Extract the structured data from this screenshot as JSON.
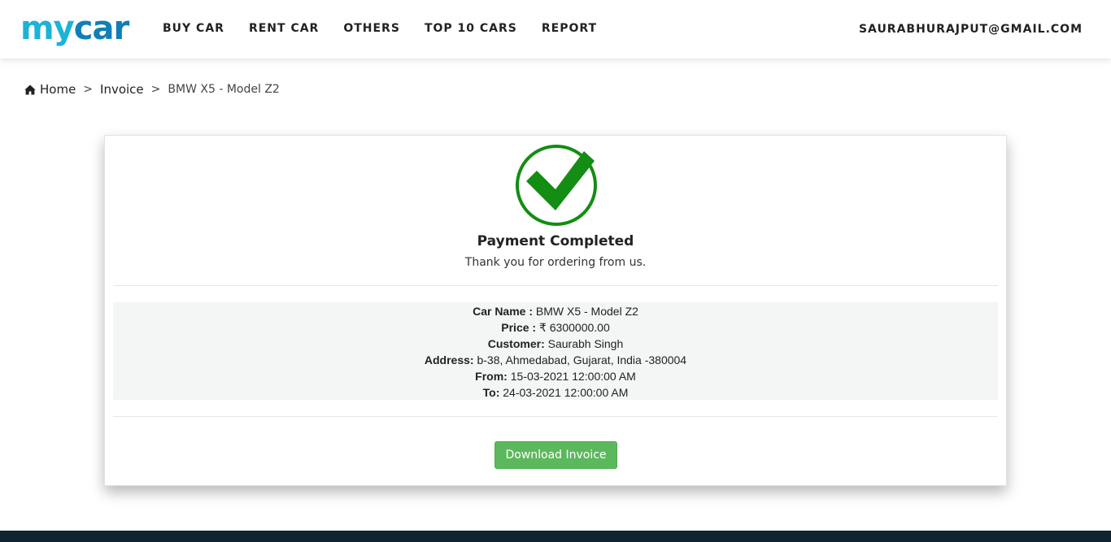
{
  "brand": {
    "logo_part1": "my",
    "logo_part2": "car",
    "colors": {
      "logo_light": "#1cb3d6",
      "logo_dark": "#0f7fb7"
    }
  },
  "nav": {
    "items": [
      {
        "label": "BUY CAR"
      },
      {
        "label": "RENT CAR"
      },
      {
        "label": "OTHERS"
      },
      {
        "label": "TOP 10 CARS"
      },
      {
        "label": "REPORT"
      }
    ],
    "user_email": "SAURABHURAJPUT@GMAIL.COM"
  },
  "breadcrumb": {
    "home_icon": "home-icon",
    "home": "Home",
    "separator": ">",
    "invoice": "Invoice",
    "current": "BMW X5 - Model Z2"
  },
  "payment": {
    "status_icon": "check-circle-icon",
    "status_color": "#138d13",
    "title": "Payment Completed",
    "subtitle": "Thank you for ordering from us."
  },
  "details": {
    "car_name_label": "Car Name :",
    "car_name": " BMW X5 - Model Z2",
    "price_label": "Price :",
    "price": " ₹ 6300000.00",
    "customer_label": "Customer:",
    "customer": " Saurabh Singh",
    "address_label": "Address:",
    "address": " b-38, Ahmedabad, Gujarat, India -380004",
    "from_label": "From:",
    "from": " 15-03-2021 12:00:00 AM",
    "to_label": "To:",
    "to": " 24-03-2021 12:00:00 AM"
  },
  "actions": {
    "download_label": "Download Invoice",
    "button_color": "#5cb85c"
  },
  "footer": {
    "color": "#0f2430"
  }
}
